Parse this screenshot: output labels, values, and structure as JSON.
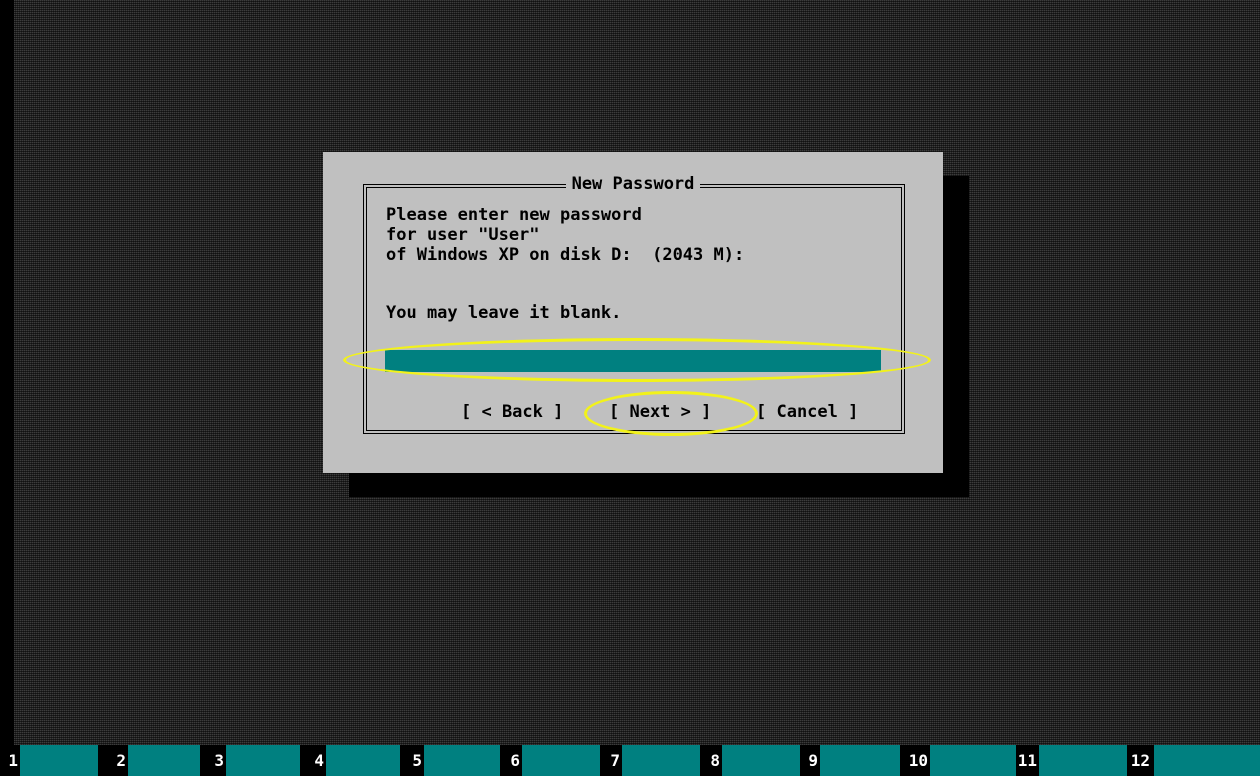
{
  "dialog": {
    "title": "New Password",
    "lines": [
      "Please enter new password",
      "for user \"User\"",
      "of Windows XP on disk D:  (2043 M):",
      "You may leave it blank."
    ],
    "password_value": "",
    "back_label": "[ < Back ]",
    "next_label": "[ Next > ]",
    "cancel_label": "[ Cancel ]"
  },
  "fkeys": [
    "1",
    "2",
    "3",
    "4",
    "5",
    "6",
    "7",
    "8",
    "9",
    "10",
    "11",
    "12"
  ],
  "colors": {
    "dialog_bg": "#c0c0c0",
    "field_bg": "#008080",
    "fkey_bg": "#008080",
    "highlight": "#f2f21a"
  }
}
